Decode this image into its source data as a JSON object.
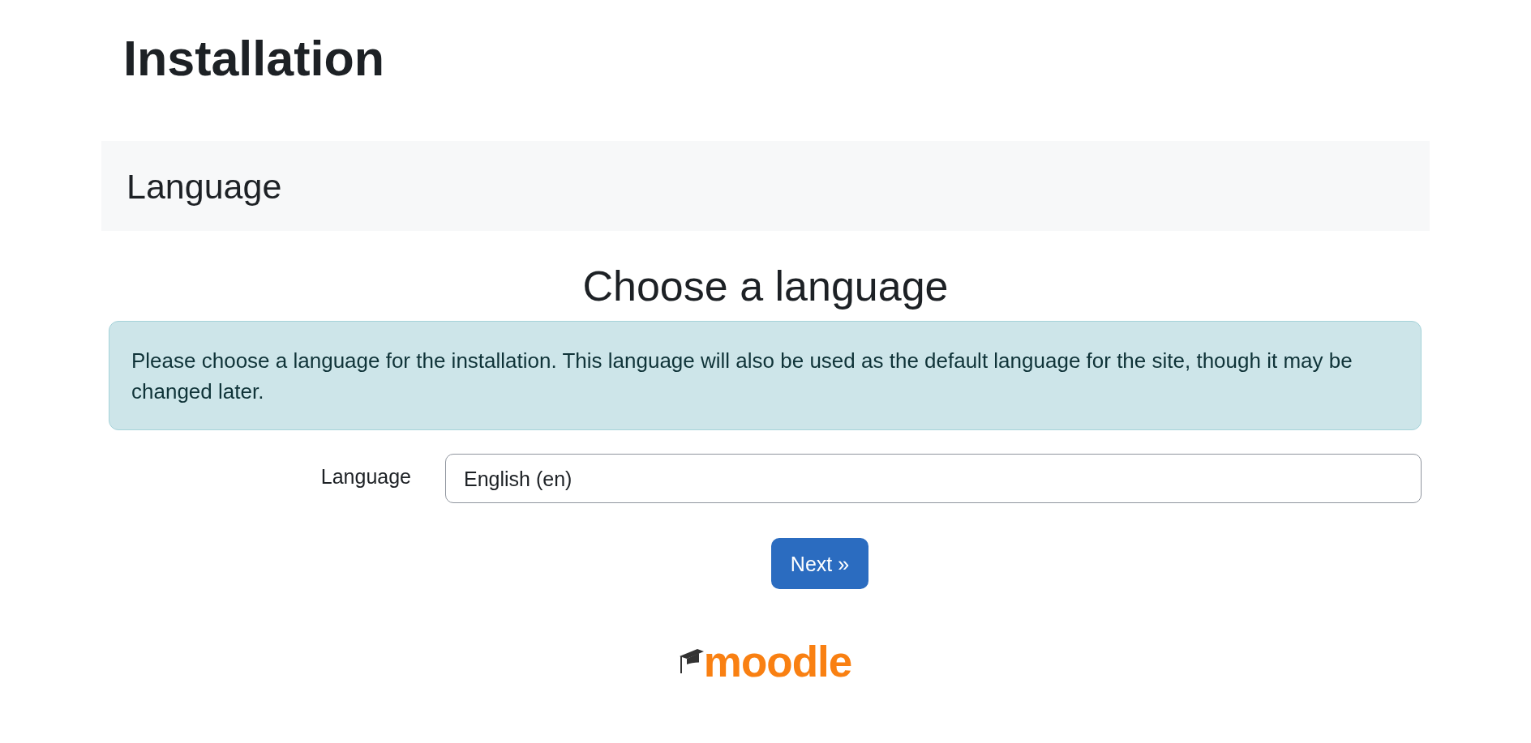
{
  "page": {
    "title": "Installation"
  },
  "section": {
    "heading": "Language"
  },
  "form": {
    "heading": "Choose a language",
    "notice": "Please choose a language for the installation. This language will also be used as the default language for the site, though it may be changed later.",
    "fields": [
      {
        "label": "Language",
        "value": "English (en)"
      }
    ],
    "buttons": [
      {
        "label": "Next »"
      }
    ]
  },
  "footer": {
    "logo_text": "moodle"
  }
}
